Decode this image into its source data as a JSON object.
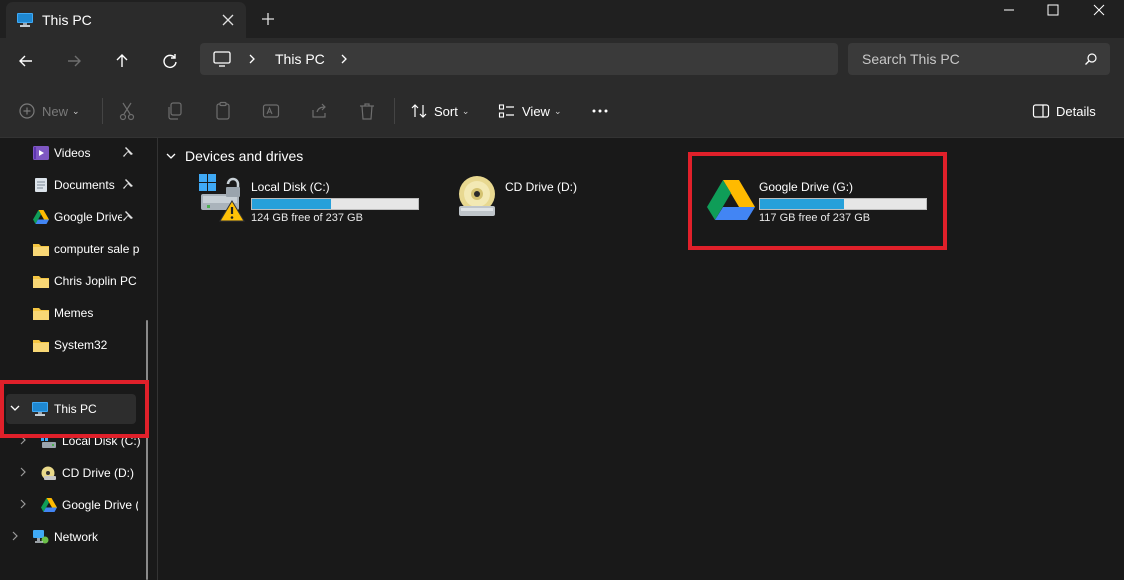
{
  "window": {
    "tab_title": "This PC"
  },
  "address_bar": {
    "location": "This PC"
  },
  "search": {
    "placeholder": "Search This PC"
  },
  "toolbar": {
    "new_label": "New",
    "sort_label": "Sort",
    "view_label": "View",
    "details_label": "Details"
  },
  "sidebar": {
    "quick_access": [
      {
        "label": "Videos",
        "icon": "videos-folder-icon",
        "pinned": true
      },
      {
        "label": "Documents",
        "icon": "documents-folder-icon",
        "pinned": true
      },
      {
        "label": "Google Drive",
        "icon": "google-drive-icon",
        "pinned": true
      },
      {
        "label": "computer sale p",
        "icon": "folder-icon",
        "pinned": false
      },
      {
        "label": "Chris Joplin PC i",
        "icon": "folder-icon",
        "pinned": false
      },
      {
        "label": "Memes",
        "icon": "folder-icon",
        "pinned": false
      },
      {
        "label": "System32",
        "icon": "folder-icon",
        "pinned": false
      }
    ],
    "this_pc": {
      "label": "This PC",
      "expanded": true,
      "selected": true
    },
    "this_pc_children": [
      {
        "label": "Local Disk (C:)",
        "icon": "local-disk-icon"
      },
      {
        "label": "CD Drive (D:)",
        "icon": "cd-drive-icon"
      },
      {
        "label": "Google Drive (",
        "icon": "google-drive-icon"
      }
    ],
    "network": {
      "label": "Network"
    }
  },
  "main": {
    "group_title": "Devices and drives",
    "drives": [
      {
        "name": "Local Disk (C:)",
        "free_text": "124 GB free of 237 GB",
        "used_fraction": 0.477,
        "icon": "local-disk-warning-icon"
      },
      {
        "name": "CD Drive (D:)",
        "free_text": "",
        "used_fraction": null,
        "icon": "cd-drive-icon"
      },
      {
        "name": "Google Drive (G:)",
        "free_text": "117 GB free of 237 GB",
        "used_fraction": 0.506,
        "icon": "google-drive-icon"
      }
    ]
  },
  "colors": {
    "accent": "#26a0da",
    "highlight": "#e0202a",
    "background": "#191919",
    "chrome": "#2b2b2b"
  }
}
